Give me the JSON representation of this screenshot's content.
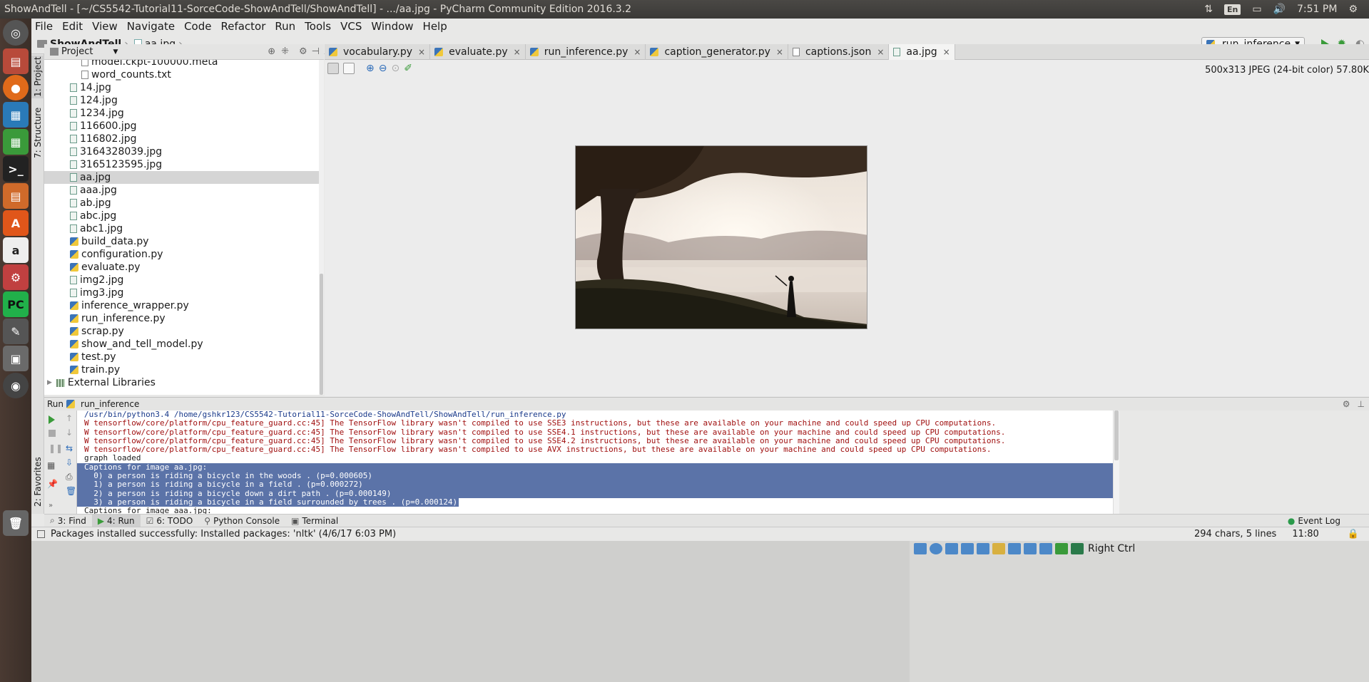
{
  "window": {
    "title": "ShowAndTell - [~/CS5542-Tutorial11-SorceCode-ShowAndTell/ShowAndTell] - .../aa.jpg - PyCharm Community Edition 2016.3.2",
    "lang": "En",
    "clock": "7:51 PM"
  },
  "menu": [
    "File",
    "Edit",
    "View",
    "Navigate",
    "Code",
    "Refactor",
    "Run",
    "Tools",
    "VCS",
    "Window",
    "Help"
  ],
  "nav": {
    "project": "ShowAndTell",
    "file": "aa.jpg",
    "run_config": "run_inference"
  },
  "sidebar_tabs": {
    "project": "1: Project",
    "structure": "7: Structure",
    "favorites": "2: Favorites"
  },
  "project_panel": {
    "title": "Project",
    "items": [
      {
        "label": "model.ckpt-100000.meta",
        "type": "txt",
        "indent": 2
      },
      {
        "label": "word_counts.txt",
        "type": "txt",
        "indent": 2
      },
      {
        "label": "14.jpg",
        "type": "img",
        "indent": 1
      },
      {
        "label": "124.jpg",
        "type": "img",
        "indent": 1
      },
      {
        "label": "1234.jpg",
        "type": "img",
        "indent": 1
      },
      {
        "label": "116600.jpg",
        "type": "img",
        "indent": 1
      },
      {
        "label": "116802.jpg",
        "type": "img",
        "indent": 1
      },
      {
        "label": "3164328039.jpg",
        "type": "img",
        "indent": 1
      },
      {
        "label": "3165123595.jpg",
        "type": "img",
        "indent": 1
      },
      {
        "label": "aa.jpg",
        "type": "img",
        "indent": 1,
        "selected": true
      },
      {
        "label": "aaa.jpg",
        "type": "img",
        "indent": 1
      },
      {
        "label": "ab.jpg",
        "type": "img",
        "indent": 1
      },
      {
        "label": "abc.jpg",
        "type": "img",
        "indent": 1
      },
      {
        "label": "abc1.jpg",
        "type": "img",
        "indent": 1
      },
      {
        "label": "build_data.py",
        "type": "py",
        "indent": 1
      },
      {
        "label": "configuration.py",
        "type": "py",
        "indent": 1
      },
      {
        "label": "evaluate.py",
        "type": "py",
        "indent": 1
      },
      {
        "label": "img2.jpg",
        "type": "img",
        "indent": 1
      },
      {
        "label": "img3.jpg",
        "type": "img",
        "indent": 1
      },
      {
        "label": "inference_wrapper.py",
        "type": "py",
        "indent": 1
      },
      {
        "label": "run_inference.py",
        "type": "py",
        "indent": 1
      },
      {
        "label": "scrap.py",
        "type": "py",
        "indent": 1
      },
      {
        "label": "show_and_tell_model.py",
        "type": "py",
        "indent": 1
      },
      {
        "label": "test.py",
        "type": "py",
        "indent": 1
      },
      {
        "label": "train.py",
        "type": "py",
        "indent": 1
      },
      {
        "label": "External Libraries",
        "type": "lib",
        "indent": 0
      }
    ]
  },
  "tabs": [
    {
      "label": "vocabulary.py",
      "type": "py"
    },
    {
      "label": "evaluate.py",
      "type": "py"
    },
    {
      "label": "run_inference.py",
      "type": "py"
    },
    {
      "label": "caption_generator.py",
      "type": "py"
    },
    {
      "label": "captions.json",
      "type": "json"
    },
    {
      "label": "aa.jpg",
      "type": "img",
      "active": true
    }
  ],
  "viewer": {
    "info": "500x313 JPEG (24-bit color) 57.80K"
  },
  "run": {
    "label": "Run",
    "config": "run_inference",
    "lines": [
      {
        "text": "/usr/bin/python3.4 /home/gshkr123/CS5542-Tutorial11-SorceCode-ShowAndTell/ShowAndTell/run_inference.py",
        "kind": "cmd"
      },
      {
        "text": "W tensorflow/core/platform/cpu_feature_guard.cc:45] The TensorFlow library wasn't compiled to use SSE3 instructions, but these are available on your machine and could speed up CPU computations.",
        "kind": "err"
      },
      {
        "text": "W tensorflow/core/platform/cpu_feature_guard.cc:45] The TensorFlow library wasn't compiled to use SSE4.1 instructions, but these are available on your machine and could speed up CPU computations.",
        "kind": "err"
      },
      {
        "text": "W tensorflow/core/platform/cpu_feature_guard.cc:45] The TensorFlow library wasn't compiled to use SSE4.2 instructions, but these are available on your machine and could speed up CPU computations.",
        "kind": "err"
      },
      {
        "text": "W tensorflow/core/platform/cpu_feature_guard.cc:45] The TensorFlow library wasn't compiled to use AVX instructions, but these are available on your machine and could speed up CPU computations.",
        "kind": "err"
      },
      {
        "text": "graph loaded",
        "kind": "out"
      },
      {
        "text": "Captions for image aa.jpg:",
        "kind": "hl"
      },
      {
        "text": "  0) a person is riding a bicycle in the woods . (p=0.000605)",
        "kind": "hl"
      },
      {
        "text": "  1) a person is riding a bicycle in a field . (p=0.000272)",
        "kind": "hl"
      },
      {
        "text": "  2) a person is riding a bicycle down a dirt path . (p=0.000149)",
        "kind": "hl"
      },
      {
        "text": "  3) a person is riding a bicycle in a field surrounded by trees . (p=0.000124)",
        "kind": "hlp"
      },
      {
        "text": "Captions for image aaa.jpg:",
        "kind": "out"
      }
    ]
  },
  "bottom_tabs": [
    {
      "label": "3: Find",
      "icon": "search-icon"
    },
    {
      "label": "4: Run",
      "icon": "run-icon",
      "active": true
    },
    {
      "label": "6: TODO",
      "icon": "todo-icon"
    },
    {
      "label": "Python Console",
      "icon": "python-icon"
    },
    {
      "label": "Terminal",
      "icon": "terminal-icon"
    }
  ],
  "event_log": "Event Log",
  "status": {
    "message": "Packages installed successfully: Installed packages: 'nltk' (4/6/17 6:03 PM)",
    "chars": "294 chars, 5 lines",
    "position": "11:80"
  },
  "tray": {
    "right_ctrl": "Right Ctrl"
  }
}
